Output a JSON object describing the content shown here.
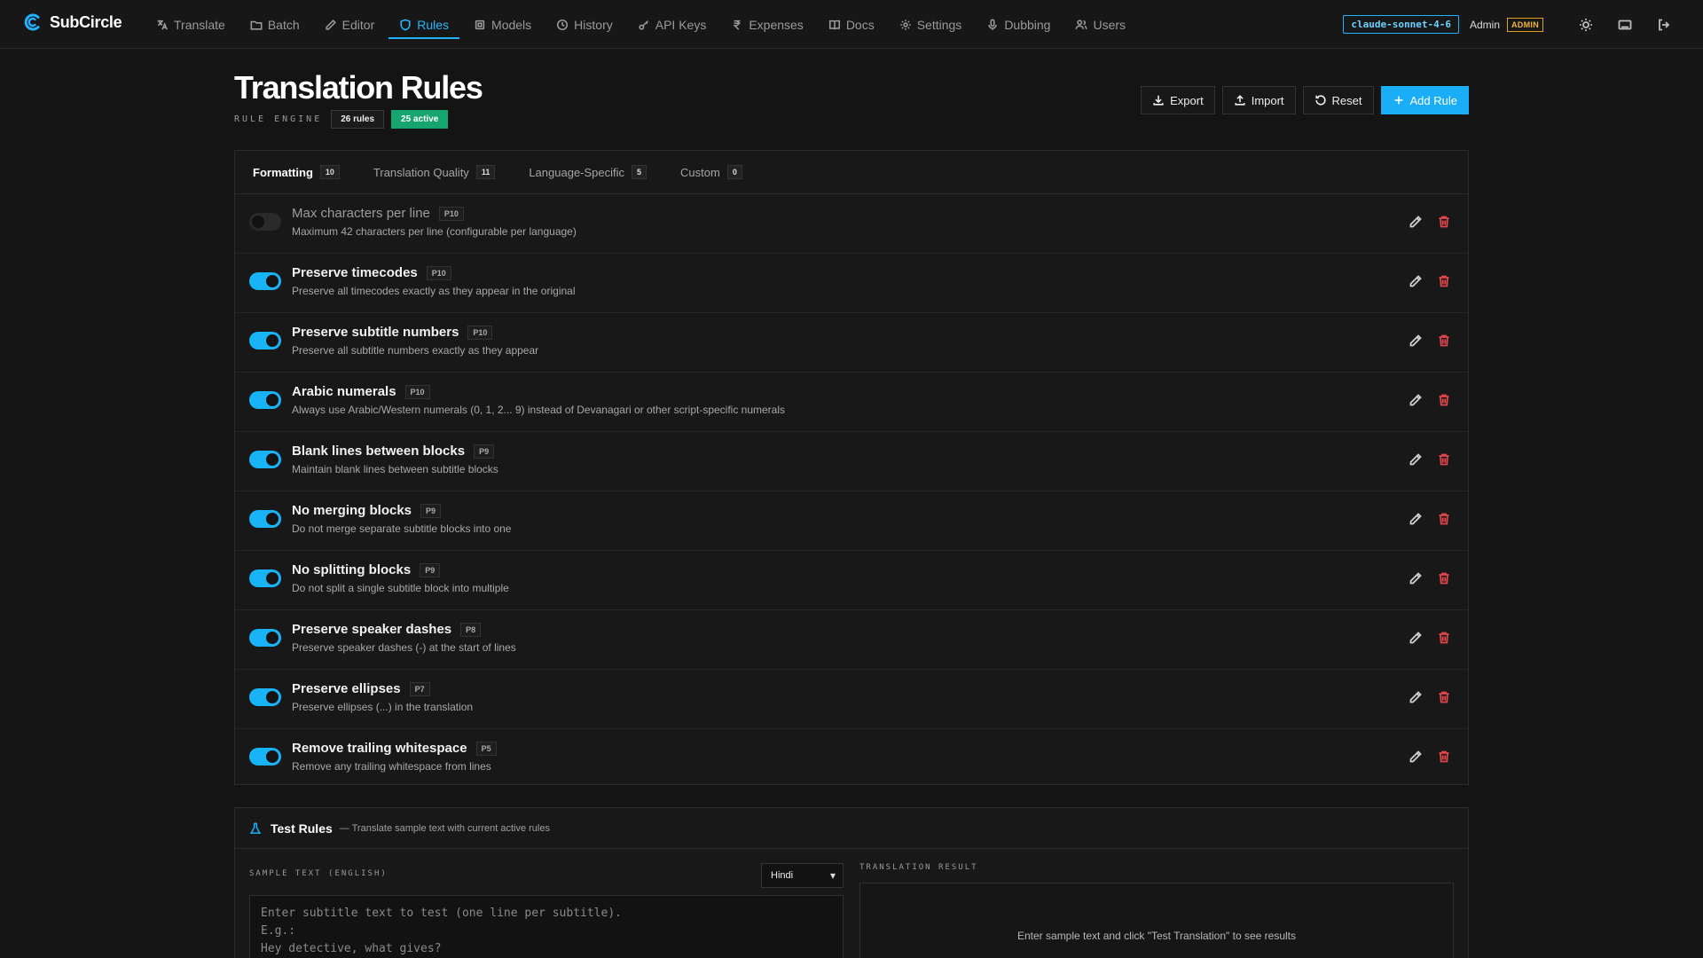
{
  "brand": {
    "name": "SubCircle"
  },
  "nav": {
    "items": [
      {
        "label": "Translate",
        "icon": "translate-icon"
      },
      {
        "label": "Batch",
        "icon": "folder-icon"
      },
      {
        "label": "Editor",
        "icon": "pencil-icon"
      },
      {
        "label": "Rules",
        "icon": "shield-icon",
        "active": true
      },
      {
        "label": "Models",
        "icon": "cpu-icon"
      },
      {
        "label": "History",
        "icon": "clock-icon"
      },
      {
        "label": "API Keys",
        "icon": "key-icon"
      },
      {
        "label": "Expenses",
        "icon": "rupee-icon"
      },
      {
        "label": "Docs",
        "icon": "book-icon"
      },
      {
        "label": "Settings",
        "icon": "gear-icon"
      },
      {
        "label": "Dubbing",
        "icon": "mic-icon"
      },
      {
        "label": "Users",
        "icon": "users-icon"
      }
    ],
    "model": "claude-sonnet-4-6",
    "user": "Admin",
    "role_badge": "ADMIN"
  },
  "header": {
    "title": "Translation Rules",
    "engine_label": "RULE ENGINE",
    "rules_count": "26 rules",
    "active_count": "25 active",
    "actions": {
      "export": "Export",
      "import": "Import",
      "reset": "Reset",
      "add": "Add Rule"
    }
  },
  "tabs": [
    {
      "label": "Formatting",
      "count": "10",
      "active": true
    },
    {
      "label": "Translation Quality",
      "count": "11"
    },
    {
      "label": "Language-Specific",
      "count": "5"
    },
    {
      "label": "Custom",
      "count": "0"
    }
  ],
  "rules": [
    {
      "title": "Max characters per line",
      "priority": "P10",
      "desc": "Maximum 42 characters per line (configurable per language)",
      "enabled": false
    },
    {
      "title": "Preserve timecodes",
      "priority": "P10",
      "desc": "Preserve all timecodes exactly as they appear in the original",
      "enabled": true
    },
    {
      "title": "Preserve subtitle numbers",
      "priority": "P10",
      "desc": "Preserve all subtitle numbers exactly as they appear",
      "enabled": true
    },
    {
      "title": "Arabic numerals",
      "priority": "P10",
      "desc": "Always use Arabic/Western numerals (0, 1, 2... 9) instead of Devanagari or other script-specific numerals",
      "enabled": true
    },
    {
      "title": "Blank lines between blocks",
      "priority": "P9",
      "desc": "Maintain blank lines between subtitle blocks",
      "enabled": true
    },
    {
      "title": "No merging blocks",
      "priority": "P9",
      "desc": "Do not merge separate subtitle blocks into one",
      "enabled": true
    },
    {
      "title": "No splitting blocks",
      "priority": "P9",
      "desc": "Do not split a single subtitle block into multiple",
      "enabled": true
    },
    {
      "title": "Preserve speaker dashes",
      "priority": "P8",
      "desc": "Preserve speaker dashes (-) at the start of lines",
      "enabled": true
    },
    {
      "title": "Preserve ellipses",
      "priority": "P7",
      "desc": "Preserve ellipses (...) in the translation",
      "enabled": true
    },
    {
      "title": "Remove trailing whitespace",
      "priority": "P5",
      "desc": "Remove any trailing whitespace from lines",
      "enabled": true
    }
  ],
  "test": {
    "title": "Test Rules",
    "subtitle": "— Translate sample text with current active rules",
    "sample_label": "SAMPLE TEXT (ENGLISH)",
    "language": "Hindi",
    "placeholder": "Enter subtitle text to test (one line per subtitle).\nE.g.:\nHey detective, what gives?",
    "result_label": "TRANSLATION RESULT",
    "result_empty": "Enter sample text and click \"Test Translation\" to see results"
  },
  "colors": {
    "accent": "#19aef7",
    "success": "#17a56f",
    "danger": "#e0464a",
    "warning": "#e0a21c"
  }
}
